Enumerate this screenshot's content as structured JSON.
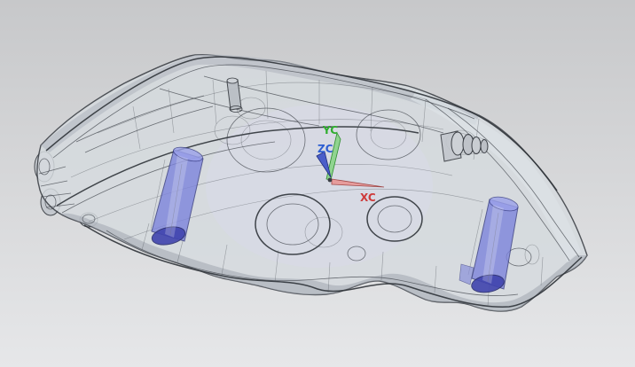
{
  "viewport": {
    "name": "cad-3d-viewport",
    "description": "Translucent wireframe view of a brake caliper model",
    "background": {
      "top": "#c7c8ca",
      "bottom": "#e6e7e9"
    },
    "model": {
      "label": "brake-caliper",
      "body_fill": "#d6dbdf",
      "edge_color": "#35393f",
      "shade_color": "#9ba1ab",
      "tint_color": "#d9d9ea"
    },
    "pistons": {
      "label": "piston",
      "fill": "#7b82dc",
      "dark": "#4044ae",
      "top": "#9ba1ea",
      "count_visible": 2
    },
    "triad": {
      "label": "work-coordinate-system",
      "axes": [
        {
          "id": "xc",
          "label": "XC",
          "label_color": "#ce3b3b",
          "arrow_color": "#e69c9c"
        },
        {
          "id": "yc",
          "label": "YC",
          "label_color": "#2fae2f",
          "arrow_color": "#90d490"
        },
        {
          "id": "zc",
          "label": "ZC",
          "label_color": "#2d5ed2",
          "arrow_color": "#4a5ec9"
        }
      ]
    }
  }
}
